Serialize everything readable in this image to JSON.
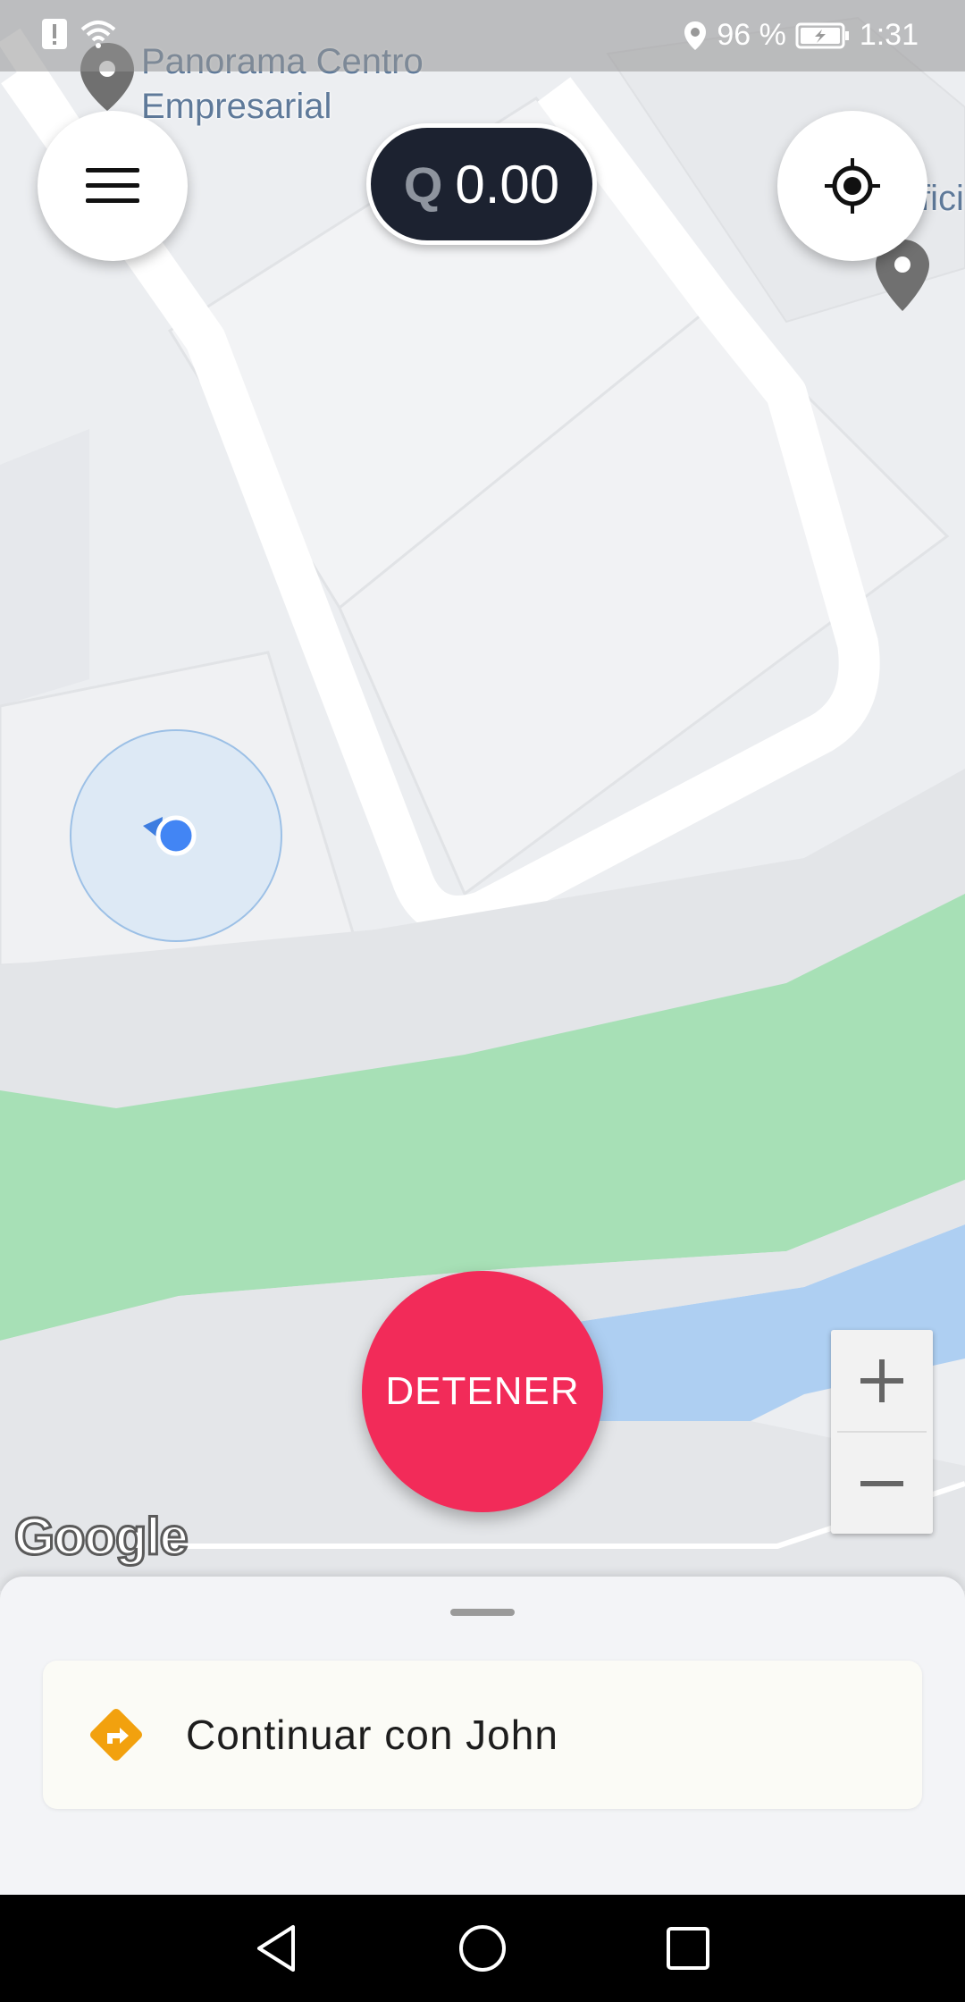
{
  "status_bar": {
    "battery_percent": "96 %",
    "time": "1:31",
    "icons": [
      "alert-icon",
      "wifi-icon",
      "location-icon",
      "battery-charging-icon"
    ]
  },
  "map": {
    "poi_label": "Panorama Centro Empresarial",
    "poi_label_right": "fici",
    "attribution": "Google",
    "colors": {
      "park": "#a7e0b6",
      "water": "#aecff2",
      "road": "#ffffff",
      "ground": "#eceef1"
    }
  },
  "header": {
    "menu_icon": "hamburger-menu-icon",
    "fare_currency": "Q",
    "fare_amount": "0.00",
    "locate_icon": "my-location-icon"
  },
  "actions": {
    "stop_label": "DETENER",
    "stop_color": "#f22b59",
    "zoom_in": "+",
    "zoom_out": "−"
  },
  "sheet": {
    "continue_label": "Continuar con John",
    "continue_icon": "turn-right-diamond-icon",
    "accent": "#f2a10e"
  },
  "navbar": {
    "icons": [
      "back-icon",
      "home-icon",
      "recents-icon"
    ]
  }
}
